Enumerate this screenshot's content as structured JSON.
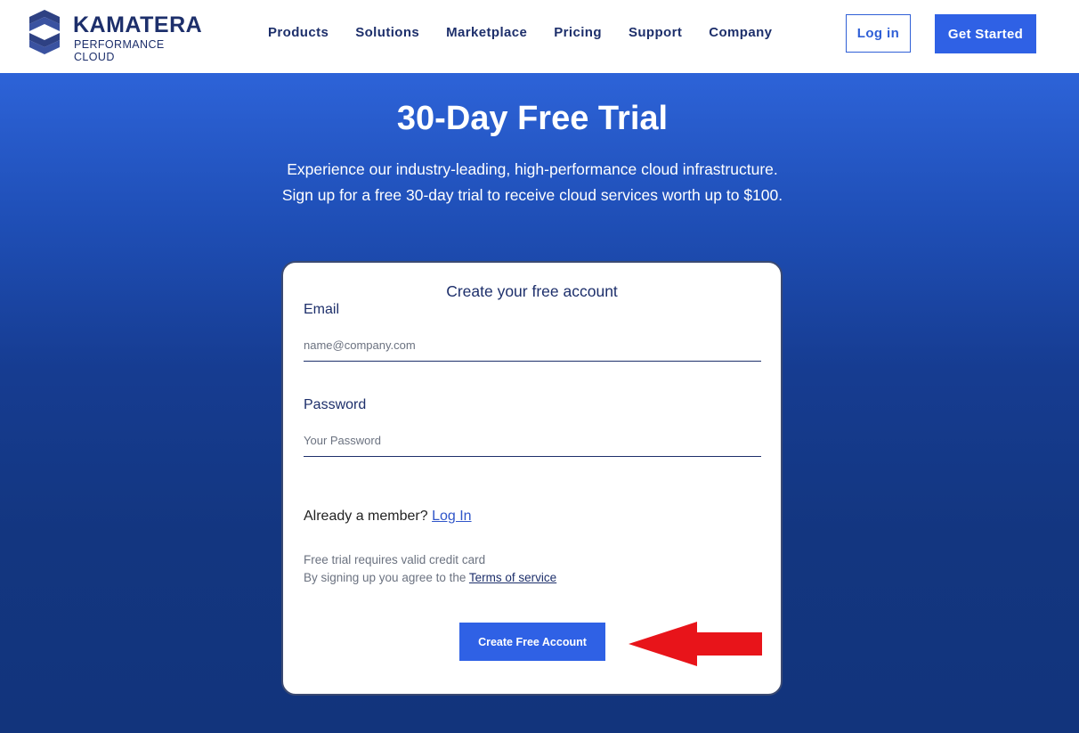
{
  "header": {
    "logo": {
      "name": "KAMATERA",
      "tagline": "PERFORMANCE CLOUD"
    },
    "nav": [
      {
        "label": "Products"
      },
      {
        "label": "Solutions"
      },
      {
        "label": "Marketplace"
      },
      {
        "label": "Pricing"
      },
      {
        "label": "Support"
      },
      {
        "label": "Company"
      }
    ],
    "login_label": "Log in",
    "get_started_label": "Get Started"
  },
  "hero": {
    "title": "30-Day Free Trial",
    "subtitle_line1": "Experience our industry-leading, high-performance cloud infrastructure.",
    "subtitle_line2": "Sign up for a free 30-day trial to receive cloud services worth up to $100."
  },
  "form": {
    "title": "Create your free account",
    "email": {
      "label": "Email",
      "placeholder": "name@company.com",
      "value": ""
    },
    "password": {
      "label": "Password",
      "placeholder": "Your Password",
      "value": ""
    },
    "member_text": "Already a member?",
    "member_link": "Log In",
    "note_line1": "Free trial requires valid credit card",
    "note_line2_prefix": "By signing up you agree to the",
    "terms_link": "Terms of service",
    "submit_label": "Create Free Account"
  },
  "annotation": {
    "arrow_color": "#e8141a",
    "icon": "red-arrow-left-icon"
  },
  "colors": {
    "brand_navy": "#1d2f6b",
    "accent_blue": "#2f61e5",
    "hero_top": "#2d63d8",
    "hero_bottom": "#12347c"
  }
}
